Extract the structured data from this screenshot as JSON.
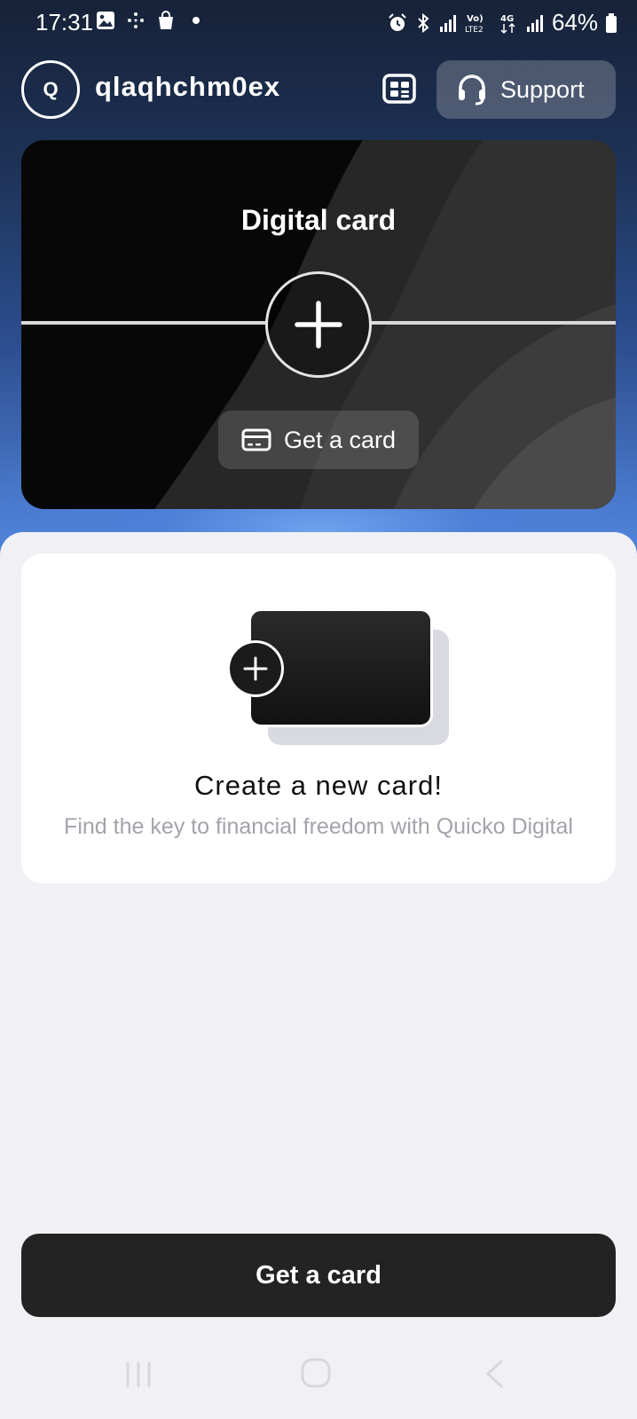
{
  "status_bar": {
    "time": "17:31",
    "battery": "64%",
    "left_icons": [
      "image-icon",
      "sparkle-icon",
      "bag-icon",
      "dot-icon"
    ],
    "right_icons": [
      "alarm-icon",
      "bluetooth-icon",
      "signal-icon",
      "volte-icon",
      "4g-icon",
      "signal-icon",
      "battery-icon"
    ],
    "volte_label": "Vo)\nLTE2",
    "network_label": "4G"
  },
  "header": {
    "avatar_letter": "Q",
    "username": "qlaqhchm0ex",
    "support_label": "Support"
  },
  "digital_card": {
    "title": "Digital card",
    "get_card_label": "Get a card"
  },
  "promo": {
    "title": "Create a new card!",
    "subtitle": "Find the key to financial freedom with Quicko Digital"
  },
  "main_button": {
    "label": "Get a card"
  },
  "colors": {
    "primary_dark": "#232323",
    "sheet_bg": "#f1f1f5",
    "accent_blue": "#4f82d8",
    "muted_text": "#a3a3ab"
  }
}
